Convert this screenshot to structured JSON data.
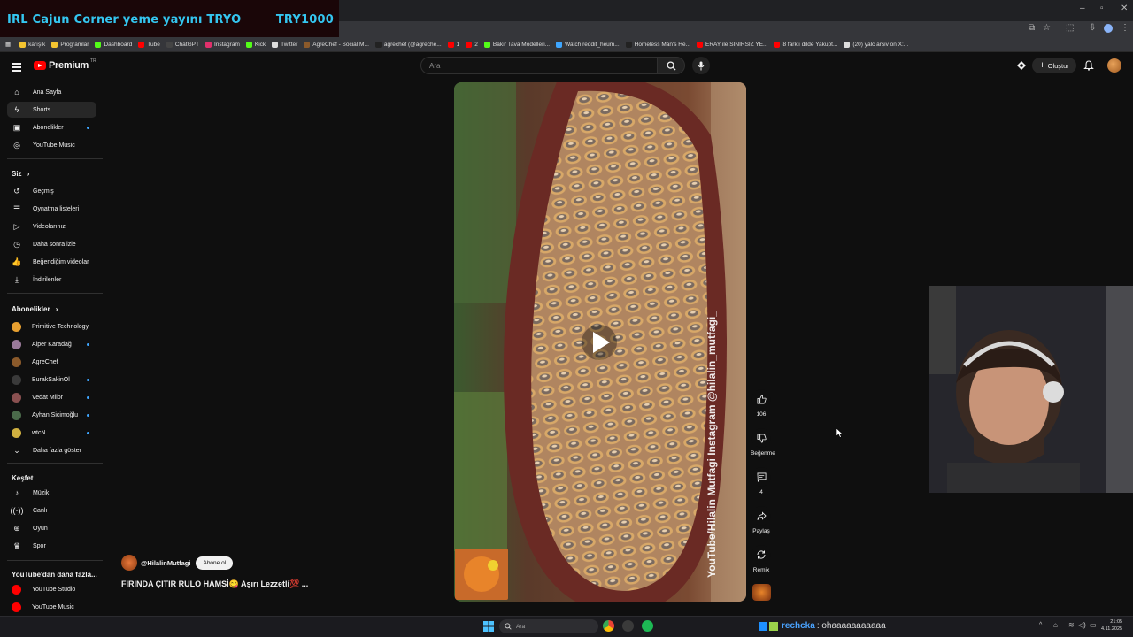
{
  "stream": {
    "title": "IRL Cajun Corner yeme yayını   TRYO",
    "code": "TRY1000"
  },
  "bookmarks": [
    {
      "label": "karışık",
      "color": "#f4c430"
    },
    {
      "label": "Programlar",
      "color": "#f4c430"
    },
    {
      "label": "Dashboard",
      "color": "#53fc18"
    },
    {
      "label": "Tube",
      "color": "#ff0000"
    },
    {
      "label": "ChatGPT",
      "color": "#444444"
    },
    {
      "label": "Instagram",
      "color": "#e1306c"
    },
    {
      "label": "Kick",
      "color": "#53fc18"
    },
    {
      "label": "Twitter",
      "color": "#dddddd"
    },
    {
      "label": "AgreChef - Social M...",
      "color": "#8b5a2b"
    },
    {
      "label": "agrechef (@agreche...",
      "color": "#222222"
    },
    {
      "label": "1",
      "color": "#ff0000"
    },
    {
      "label": "2",
      "color": "#ff0000"
    },
    {
      "label": "Bakır Tava Modelleri...",
      "color": "#53fc18"
    },
    {
      "label": "Watch reddit_heum...",
      "color": "#3ea6ff"
    },
    {
      "label": "Homeless Man's He...",
      "color": "#222222"
    },
    {
      "label": "ERAY ile SINIRSIZ YE...",
      "color": "#ff0000"
    },
    {
      "label": "8 farklı dilde Yakupt...",
      "color": "#ff0000"
    },
    {
      "label": "(20) yalc arşiv on X:...",
      "color": "#dddddd"
    }
  ],
  "header": {
    "logo": "Premium",
    "logo_region": "TR",
    "search_placeholder": "Ara",
    "create_label": "Oluştur"
  },
  "sidebar": {
    "main": [
      {
        "label": "Ana Sayfa",
        "icon": "home-icon"
      },
      {
        "label": "Shorts",
        "icon": "shorts-icon"
      },
      {
        "label": "Abonelikler",
        "icon": "subscriptions-icon"
      },
      {
        "label": "YouTube Music",
        "icon": "music-icon"
      }
    ],
    "you_heading": "Siz",
    "you": [
      {
        "label": "Geçmiş",
        "icon": "history-icon"
      },
      {
        "label": "Oynatma listeleri",
        "icon": "playlist-icon"
      },
      {
        "label": "Videolarınız",
        "icon": "your-videos-icon"
      },
      {
        "label": "Daha sonra izle",
        "icon": "clock-icon"
      },
      {
        "label": "Beğendiğim videolar",
        "icon": "thumbs-up-icon"
      },
      {
        "label": "İndirilenler",
        "icon": "download-icon"
      }
    ],
    "subs_heading": "Abonelikler",
    "subs": [
      {
        "label": "Primitive Technology",
        "color": "#e8a030",
        "dot": false
      },
      {
        "label": "Alper Karadağ",
        "color": "#9a7a9a",
        "dot": true
      },
      {
        "label": "AgreChef",
        "color": "#8b5a2b",
        "dot": false
      },
      {
        "label": "BurakSakinOl",
        "color": "#3a3a3a",
        "dot": true
      },
      {
        "label": "Vedat Milor",
        "color": "#8a5050",
        "dot": true
      },
      {
        "label": "Ayhan Sicimoğlu",
        "color": "#4a6a4a",
        "dot": true
      },
      {
        "label": "wtcN",
        "color": "#d0b040",
        "dot": true
      }
    ],
    "show_more": "Daha fazla göster",
    "explore_heading": "Keşfet",
    "explore": [
      {
        "label": "Müzik",
        "icon": "music-note-icon"
      },
      {
        "label": "Canlı",
        "icon": "live-icon"
      },
      {
        "label": "Oyun",
        "icon": "gamepad-icon"
      },
      {
        "label": "Spor",
        "icon": "trophy-icon"
      }
    ],
    "more_heading": "YouTube'dan daha fazla...",
    "more": [
      {
        "label": "YouTube Studio",
        "color": "#ff0000"
      },
      {
        "label": "YouTube Music",
        "color": "#ff0000"
      }
    ]
  },
  "short": {
    "channel": "@HilalinMutfagi",
    "subscribe": "Abone ol",
    "title": "FIRINDA ÇITIR RULO HAMSİ😋 Aşırı Lezzetli💯 ...",
    "watermark": "YouTube/Hilalin Mutfagi  Instagram @hilalin_mutfagi_"
  },
  "actions": {
    "likes": "106",
    "dislike": "Beğenme",
    "comments": "4",
    "share": "Paylaş",
    "remix": "Remix"
  },
  "taskbar": {
    "search": "Ara",
    "chat_user": "rechcka",
    "chat_msg": ": ohaaaaaaaaaaa",
    "time": "21:05",
    "date": "4.11.2025"
  }
}
